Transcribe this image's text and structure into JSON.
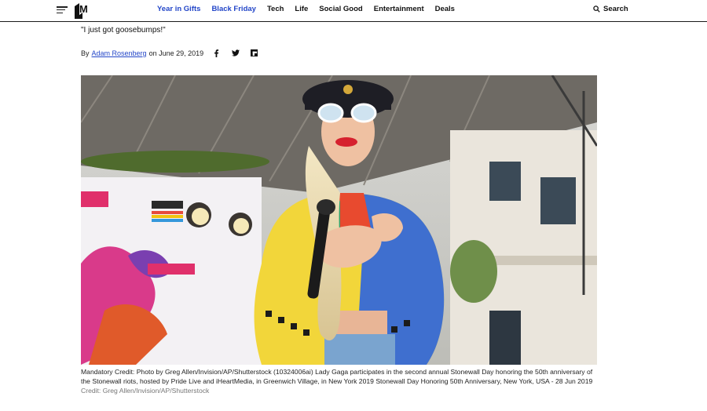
{
  "nav": {
    "logo_text": "M",
    "links": [
      {
        "label": "Year in Gifts",
        "accent": true
      },
      {
        "label": "Black Friday",
        "accent": true
      },
      {
        "label": "Tech",
        "accent": false
      },
      {
        "label": "Life",
        "accent": false
      },
      {
        "label": "Social Good",
        "accent": false
      },
      {
        "label": "Entertainment",
        "accent": false
      },
      {
        "label": "Deals",
        "accent": false
      }
    ],
    "search_label": "Search"
  },
  "article": {
    "quote": "\"I just got goosebumps!\"",
    "byline_prefix": "By",
    "author": "Adam Rosenberg",
    "date_text": "on June 29, 2019",
    "share_icons": [
      "facebook-icon",
      "twitter-icon",
      "flipboard-icon"
    ],
    "caption_text": "Mandatory Credit: Photo by Greg Allen/Invision/AP/Shutterstock (10324006ai) Lady Gaga participates in the second annual Stonewall Day honoring the 50th anniversary of the Stonewall riots, hosted by Pride Live and iHeartMedia, in Greenwich Village, in New York 2019 Stonewall Day Honoring 50th Anniversary, New York, USA - 28 Jun 2019",
    "caption_credit": "Credit: Greg Allen/Invision/AP/Shutterstock"
  },
  "colors": {
    "accent": "#2346c8",
    "text": "#111111"
  }
}
